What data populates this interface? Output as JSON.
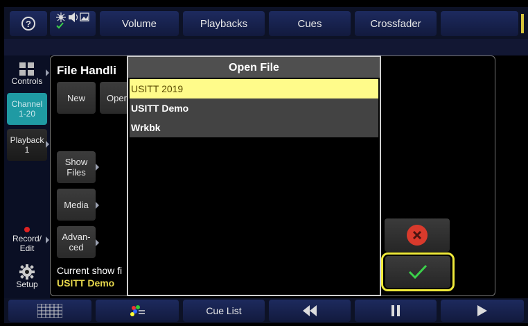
{
  "top_tabs": [
    "Volume",
    "Playbacks",
    "Cues",
    "Crossfader"
  ],
  "help_label": "?",
  "nav": {
    "controls": "Controls",
    "channel": "Channel\n1-20",
    "playback": "Playback\n1",
    "record_edit": "Record/\nEdit",
    "setup": "Setup"
  },
  "file_handling": {
    "title": "File Handli",
    "new_label": "New",
    "open_label": "Oper",
    "show_files_label": "Show\nFiles",
    "media_label": "Media",
    "advanced_label": "Advan-\nced",
    "current_label": "Current show fi",
    "current_value": "USITT Demo"
  },
  "open_file": {
    "title": "Open File",
    "files": [
      "USITT 2019",
      "USITT Demo",
      "Wrkbk"
    ],
    "selected_index": 0
  },
  "bottom": {
    "cue_list_label": "Cue List"
  },
  "colors": {
    "selected_row": "#fffb8a",
    "file_row": "#434343",
    "accent_yellow": "#e8d94c",
    "teal": "#1f9aa3",
    "cancel_red": "#d93a2c",
    "ok_green": "#3bd14a"
  }
}
